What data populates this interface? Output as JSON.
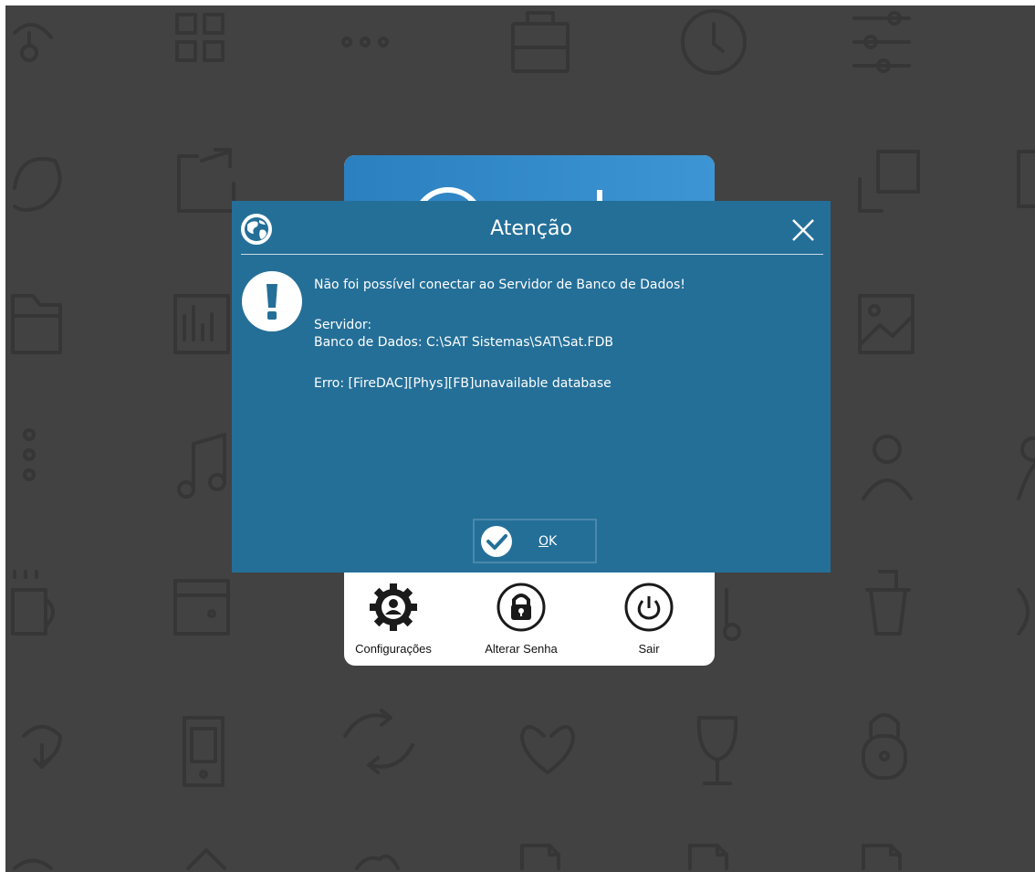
{
  "dialog": {
    "title": "Atenção",
    "message": "Não foi possível conectar ao Servidor de Banco de Dados!",
    "server_line": "Servidor:",
    "database_line": "Banco de Dados: C:\\SAT Sistemas\\SAT\\Sat.FDB",
    "error_line": "Erro: [FireDAC][Phys][FB]unavailable database",
    "ok_label": "OK",
    "icons": {
      "app": "globe-icon",
      "close": "close-icon",
      "warning": "exclamation-icon",
      "ok": "check-circle-icon"
    }
  },
  "login_toolbar": {
    "items": [
      {
        "label": "Configurações",
        "icon": "gear-user-icon"
      },
      {
        "label": "Alterar Senha",
        "icon": "lock-icon"
      },
      {
        "label": "Sair",
        "icon": "power-icon"
      }
    ]
  },
  "colors": {
    "dialog_bg": "#246f98",
    "desktop_bg": "#424242",
    "login_header": "#2b80bf"
  }
}
